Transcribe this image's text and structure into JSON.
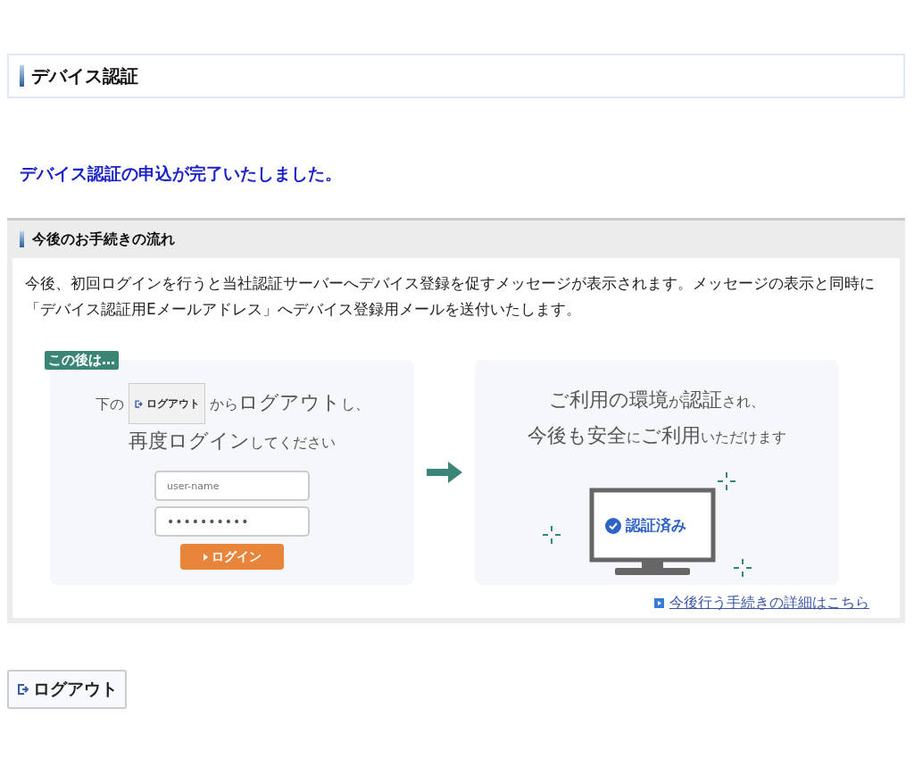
{
  "page_title": "デバイス認証",
  "completion_message": "デバイス認証の申込が完了いたしました。",
  "section": {
    "title": "今後のお手続きの流れ",
    "description": "今後、初回ログインを行うと当社認証サーバーへデバイス登録を促すメッセージが表示されます。メッセージの表示と同時に「デバイス認証用Eメールアドレス」へデバイス登録用メールを送付いたします。",
    "illustration": {
      "badge": "この後は…",
      "step1_line1": [
        {
          "text": "下の",
          "large": false
        },
        {
          "text": "ログアウト",
          "kind": "button"
        },
        {
          "text": "から",
          "large": false
        },
        {
          "text": "ログアウト",
          "large": true
        },
        {
          "text": "し、",
          "large": false
        }
      ],
      "step1_line2": [
        {
          "text": "再度ログイン",
          "large": true
        },
        {
          "text": "してください",
          "large": false
        }
      ],
      "username_placeholder": "user-name",
      "password_value": "••••••••••",
      "login_button": "ログイン",
      "step2_line1": [
        {
          "text": "ご利用の環境",
          "large": true
        },
        {
          "text": "が",
          "large": false
        },
        {
          "text": "認証",
          "large": true
        },
        {
          "text": "され、",
          "large": false
        }
      ],
      "step2_line2": [
        {
          "text": "今後も安全",
          "large": true
        },
        {
          "text": "に",
          "large": false
        },
        {
          "text": "ご利用",
          "large": true
        },
        {
          "text": "いただけます",
          "large": false
        }
      ],
      "screen_label": "認証済み"
    },
    "details_link": "今後行う手続きの詳細はこちら"
  },
  "logout_button": "ログアウト"
}
